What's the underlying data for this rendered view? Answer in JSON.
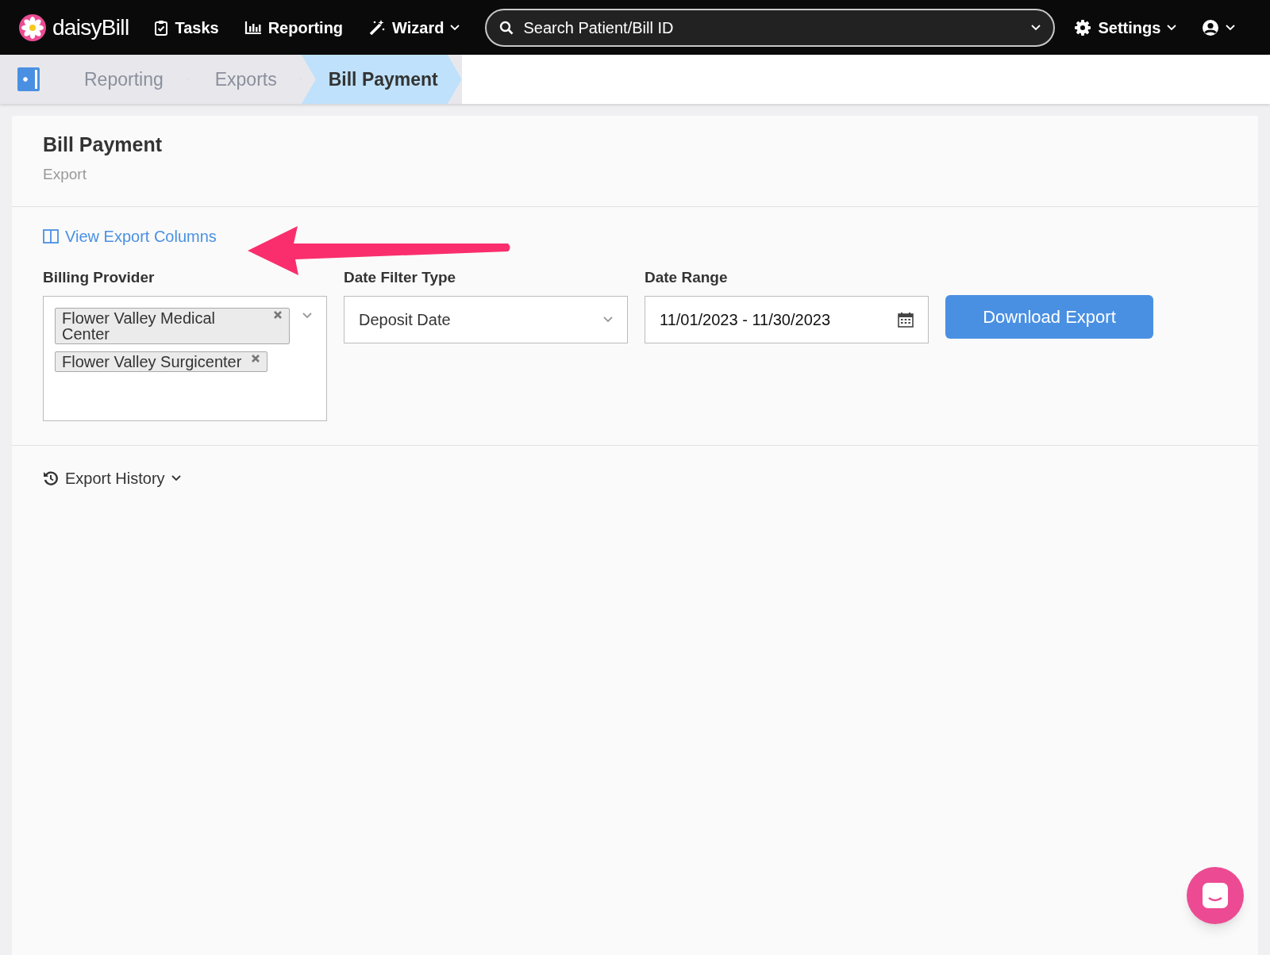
{
  "nav": {
    "brand": "daisyBill",
    "items": [
      {
        "label": "Tasks",
        "dropdown": false
      },
      {
        "label": "Reporting",
        "dropdown": false
      },
      {
        "label": "Wizard",
        "dropdown": true
      }
    ],
    "search": {
      "placeholder": "Search Patient/Bill ID"
    },
    "settings": {
      "label": "Settings"
    }
  },
  "breadcrumb": [
    {
      "label": "Reporting",
      "selected": false
    },
    {
      "label": "Exports",
      "selected": false
    },
    {
      "label": "Bill Payment",
      "selected": true
    }
  ],
  "header": {
    "title": "Bill Payment",
    "subtitle": "Export"
  },
  "columns_link": "View Export Columns",
  "filters": [
    {
      "kind": "multiselect",
      "label": "Billing Provider",
      "tags": [
        "Flower Valley Medical Center",
        "Flower Valley Surgicenter"
      ]
    },
    {
      "kind": "select",
      "label": "Date Filter Type",
      "value": "Deposit Date"
    },
    {
      "kind": "date",
      "label": "Date Range",
      "value": "11/01/2023 - 11/30/2023"
    }
  ],
  "download_button": "Download Export",
  "history": {
    "label": "Export History",
    "expanded": false
  }
}
